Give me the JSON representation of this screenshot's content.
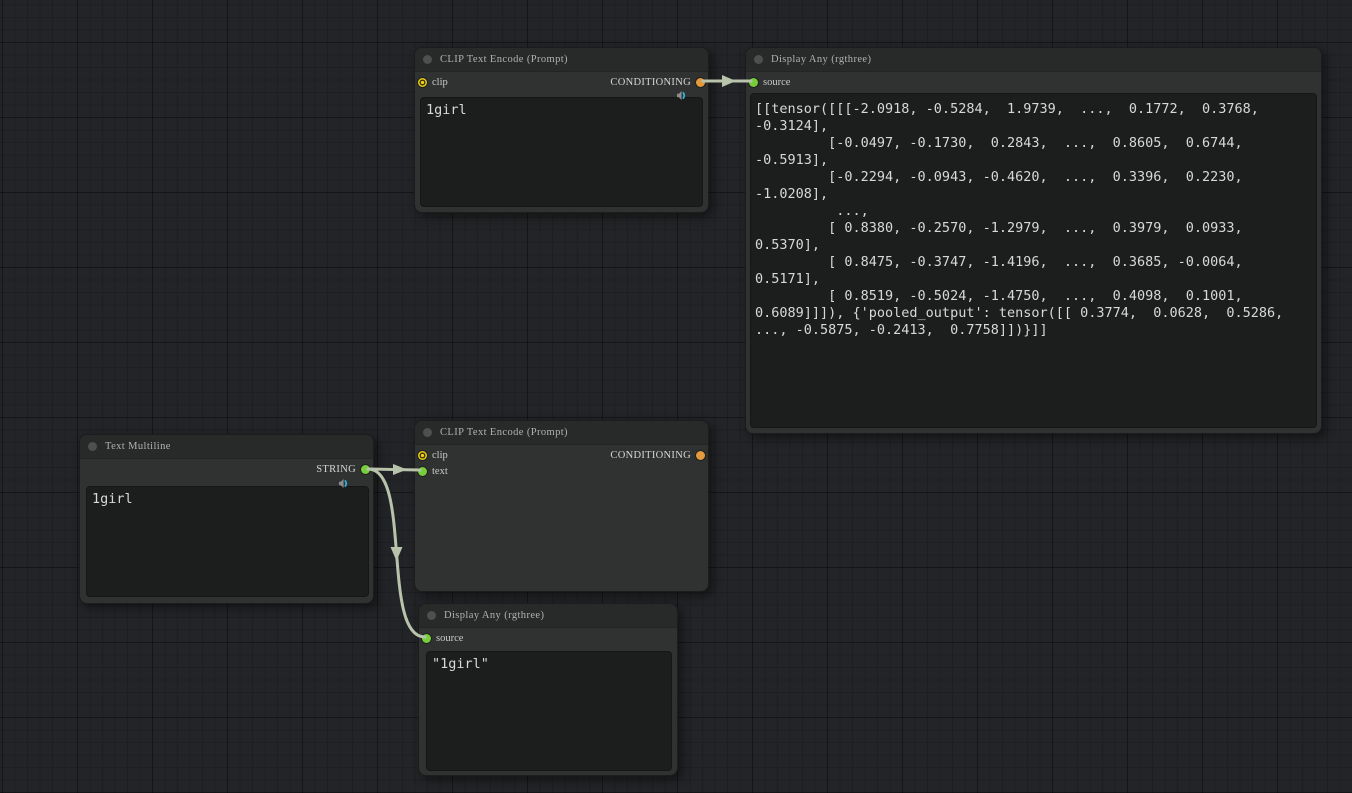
{
  "graph": {
    "colors": {
      "wire": "#b8c3ac",
      "port_green": "#76cf3a",
      "port_orange": "#e29a3c",
      "port_clip_yellow": "#e8c914",
      "speaker_icon_cyan": "#2fb3d6",
      "node_bg": "#303131",
      "node_header_bg": "#282929",
      "widget_bg": "#1c1d1d",
      "canvas_bg": "#232427"
    },
    "nodes": {
      "clip_top": {
        "title": "CLIP Text Encode (Prompt)",
        "input_clip": "clip",
        "output_conditioning": "CONDITIONING",
        "text": "1girl"
      },
      "display_top": {
        "title": "Display Any (rgthree)",
        "input_source": "source",
        "value": "[[tensor([[[-2.0918, -0.5284,  1.9739,  ...,  0.1772,  0.3768,\n-0.3124],\n         [-0.0497, -0.1730,  0.2843,  ...,  0.8605,  0.6744,\n-0.5913],\n         [-0.2294, -0.0943, -0.4620,  ...,  0.3396,  0.2230,\n-1.0208],\n          ...,\n         [ 0.8380, -0.2570, -1.2979,  ...,  0.3979,  0.0933,\n0.5370],\n         [ 0.8475, -0.3747, -1.4196,  ...,  0.3685, -0.0064,\n0.5171],\n         [ 0.8519, -0.5024, -1.4750,  ...,  0.4098,  0.1001,\n0.6089]]]), {'pooled_output': tensor([[ 0.3774,  0.0628,  0.5286,\n..., -0.5875, -0.2413,  0.7758]])}]]"
      },
      "text_multiline": {
        "title": "Text Multiline",
        "output_string": "STRING",
        "text": "1girl"
      },
      "clip_mid": {
        "title": "CLIP Text Encode (Prompt)",
        "input_clip": "clip",
        "input_text": "text",
        "output_conditioning": "CONDITIONING"
      },
      "display_bottom": {
        "title": "Display Any (rgthree)",
        "input_source": "source",
        "value": "\"1girl\""
      }
    }
  }
}
